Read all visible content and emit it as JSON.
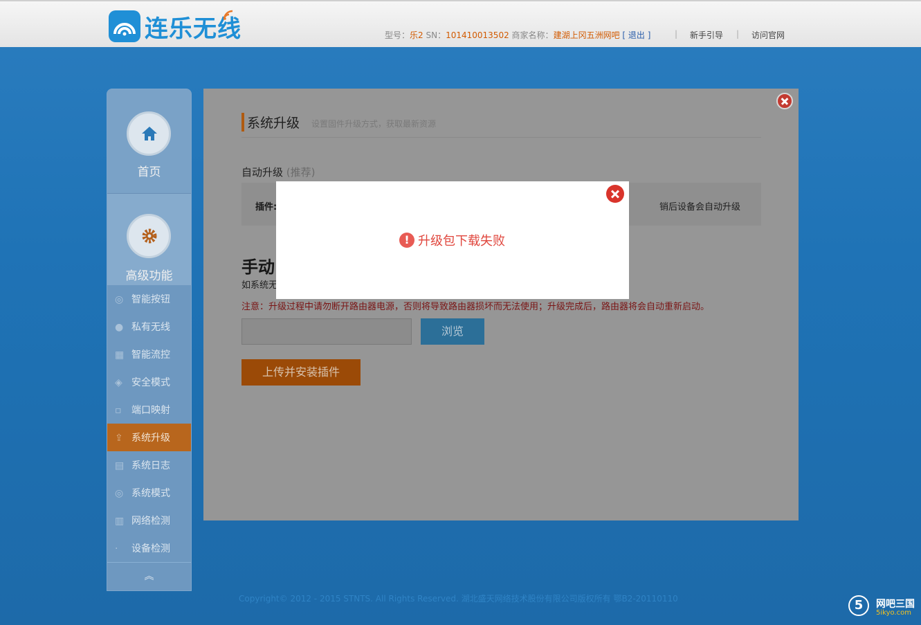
{
  "brand": {
    "name": "连乐无线"
  },
  "header": {
    "model_label": "型号：",
    "model_value": "乐2",
    "sn_label": "SN：",
    "sn_value": "101410013502",
    "merchant_label": "商家名称：",
    "merchant_value": "建湖上冈五洲网吧",
    "logout": "[ 退出 ]",
    "links": [
      "新手引导",
      "访问官网"
    ]
  },
  "sidebar": {
    "home": "首页",
    "advanced": "高级功能",
    "items": [
      {
        "label": "智能按钮",
        "icon": "wifi-icon"
      },
      {
        "label": "私有无线",
        "icon": "user-icon"
      },
      {
        "label": "智能流控",
        "icon": "flow-icon"
      },
      {
        "label": "安全模式",
        "icon": "shield-icon"
      },
      {
        "label": "端口映射",
        "icon": "port-icon"
      },
      {
        "label": "系统升级",
        "icon": "upgrade-icon",
        "active": true
      },
      {
        "label": "系统日志",
        "icon": "log-icon"
      },
      {
        "label": "系统模式",
        "icon": "mode-icon"
      },
      {
        "label": "网络检测",
        "icon": "network-icon"
      },
      {
        "label": "设备检测",
        "icon": "device-icon"
      }
    ],
    "collapse": "︽"
  },
  "main": {
    "title": "系统升级",
    "subtitle": "设置固件升级方式，获取最新资源",
    "auto": {
      "label": "自动升级",
      "tag": "(推荐)",
      "left": "插件:",
      "right": "销后设备会自动升级"
    },
    "manual": {
      "title": "手动",
      "desc": "如系统无"
    },
    "warning": "注意：升级过程中请勿断开路由器电源，否则将导致路由器损坏而无法使用；升级完成后，路由器将会自动重新启动。",
    "browse": "浏览",
    "upload": "上传并安装插件"
  },
  "dialog": {
    "message": "升级包下载失败"
  },
  "footer": "Copyright© 2012 - 2015 STNTS. All Rights Reserved. 湖北盛天网络技术股份有限公司版权所有 鄂B2-20110110",
  "watermark": {
    "title": "网吧三国",
    "site": "5ikyo.com",
    "mark": "5"
  },
  "colors": {
    "accent": "#1f8fd6",
    "active": "#b8661d",
    "error": "#e0473e"
  }
}
